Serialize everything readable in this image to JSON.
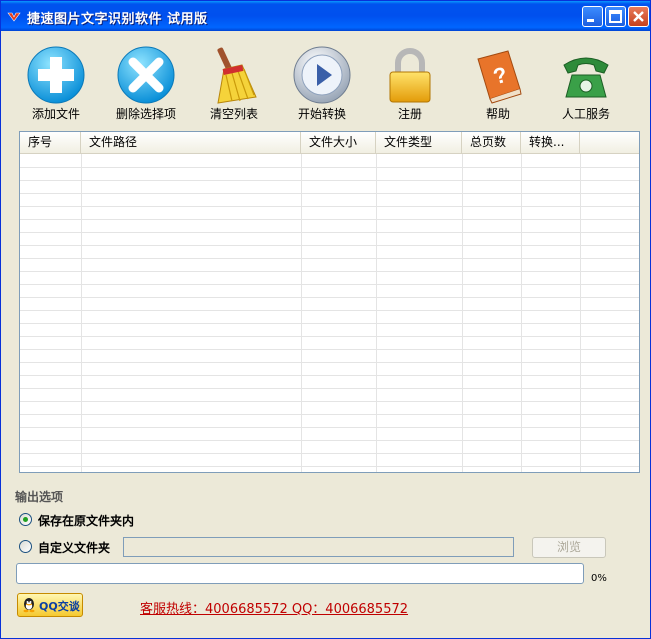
{
  "window": {
    "title": "捷速图片文字识别软件  试用版"
  },
  "toolbar": {
    "items": [
      {
        "label": "添加文件",
        "icon": "add-icon"
      },
      {
        "label": "删除选择项",
        "icon": "delete-icon"
      },
      {
        "label": "清空列表",
        "icon": "broom-icon"
      },
      {
        "label": "开始转换",
        "icon": "play-icon"
      },
      {
        "label": "注册",
        "icon": "lock-icon"
      },
      {
        "label": "帮助",
        "icon": "help-book-icon"
      },
      {
        "label": "人工服务",
        "icon": "phone-icon"
      }
    ]
  },
  "file_table": {
    "columns": [
      "序号",
      "文件路径",
      "文件大小",
      "文件类型",
      "总页数",
      "转换..."
    ],
    "rows": []
  },
  "output_options": {
    "title": "输出选项",
    "save_original_label": "保存在原文件夹内",
    "save_original_selected": true,
    "custom_folder_label": "自定义文件夹",
    "custom_folder_selected": false,
    "custom_folder_value": "",
    "browse_label": "浏览"
  },
  "progress": {
    "percent_label": "0%",
    "value": 0
  },
  "footer": {
    "qq_label": "QQ交谈",
    "hotline": "客服热线：4006685572 QQ：4006685572"
  },
  "colors": {
    "titlebar": "#0054e3",
    "hotline": "#c00000",
    "radio_dot": "#21a121"
  }
}
